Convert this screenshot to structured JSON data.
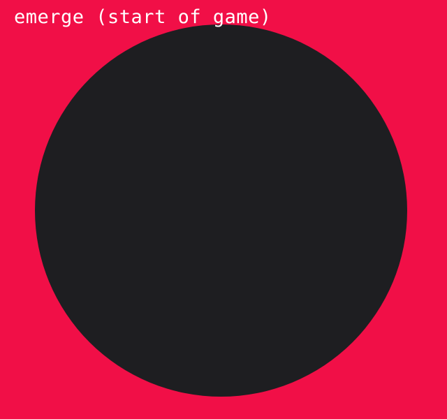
{
  "screen": {
    "title": "emerge (start of game)"
  },
  "colors": {
    "background": "#f10f47",
    "disc": "#1e1e21",
    "text": "#ffffff"
  }
}
